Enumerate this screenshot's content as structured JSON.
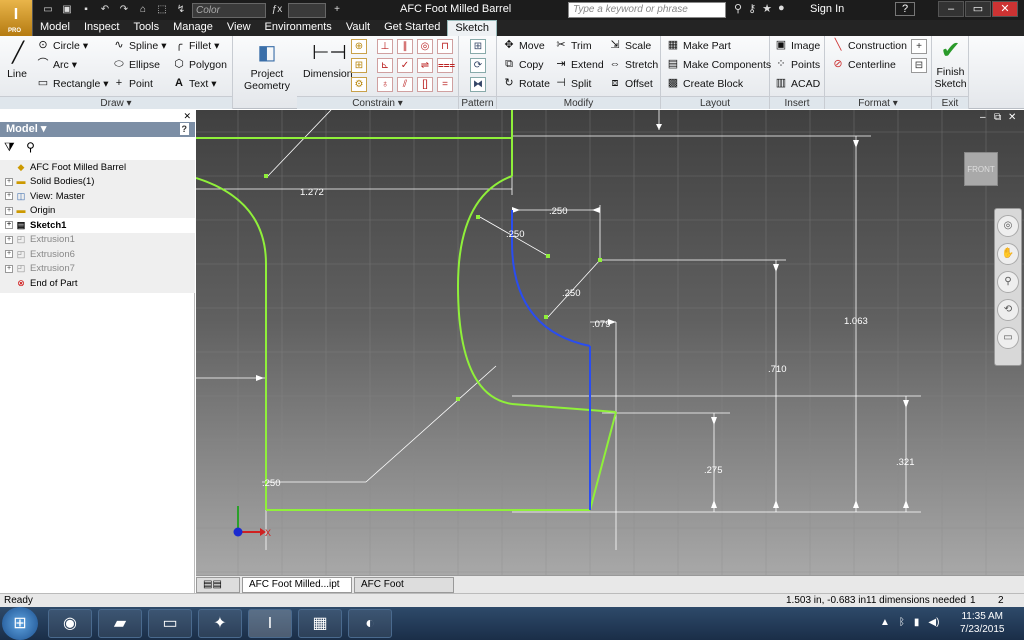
{
  "title_bar": {
    "window_title": "AFC Foot Milled Barrel",
    "color_value": "Color",
    "search_placeholder": "Type a keyword or phrase",
    "sign_in": "Sign In",
    "help": "?",
    "app_badge": "PRO"
  },
  "menu": {
    "tabs": [
      "Model",
      "Inspect",
      "Tools",
      "Manage",
      "View",
      "Environments",
      "Vault",
      "Get Started",
      "Sketch"
    ],
    "active": "Sketch"
  },
  "ribbon": {
    "draw": {
      "label": "Draw",
      "line": "Line",
      "circle": "Circle",
      "arc": "Arc",
      "rectangle": "Rectangle",
      "spline": "Spline",
      "ellipse": "Ellipse",
      "point": "Point",
      "fillet": "Fillet",
      "polygon": "Polygon",
      "text": "Text"
    },
    "project_geometry": "Project Geometry",
    "constrain": {
      "label": "Constrain",
      "dimension": "Dimension"
    },
    "pattern": {
      "label": "Pattern"
    },
    "modify": {
      "label": "Modify",
      "move": "Move",
      "copy": "Copy",
      "rotate": "Rotate",
      "trim": "Trim",
      "extend": "Extend",
      "split": "Split",
      "scale": "Scale",
      "stretch": "Stretch",
      "offset": "Offset"
    },
    "layout": {
      "label": "Layout",
      "make_part": "Make Part",
      "make_components": "Make Components",
      "create_block": "Create Block"
    },
    "insert": {
      "label": "Insert",
      "image": "Image",
      "points": "Points",
      "acad": "ACAD"
    },
    "format": {
      "label": "Format",
      "construction": "Construction",
      "centerline": "Centerline"
    },
    "exit": {
      "label": "Exit",
      "finish_sketch": "Finish Sketch"
    }
  },
  "browser": {
    "title": "Model",
    "tree": [
      {
        "label": "AFC Foot Milled Barrel",
        "state": "normal",
        "expand": false,
        "icon": "part-icon"
      },
      {
        "label": "Solid Bodies(1)",
        "state": "normal",
        "expand": true,
        "icon": "folder-icon"
      },
      {
        "label": "View: Master",
        "state": "normal",
        "expand": true,
        "icon": "view-icon"
      },
      {
        "label": "Origin",
        "state": "normal",
        "expand": true,
        "icon": "folder-icon"
      },
      {
        "label": "Sketch1",
        "state": "active",
        "expand": true,
        "icon": "sketch-icon"
      },
      {
        "label": "Extrusion1",
        "state": "dim",
        "expand": true,
        "icon": "extrusion-icon"
      },
      {
        "label": "Extrusion6",
        "state": "dim",
        "expand": true,
        "icon": "extrusion-icon"
      },
      {
        "label": "Extrusion7",
        "state": "dim",
        "expand": true,
        "icon": "extrusion-icon"
      },
      {
        "label": "End of Part",
        "state": "normal",
        "expand": false,
        "icon": "end-of-part-icon"
      }
    ]
  },
  "canvas": {
    "viewcube_label": "FRONT",
    "dimensions": [
      "1.272",
      ".250",
      ".250",
      ".250",
      ".079",
      "1.063",
      ".710",
      ".275",
      ".321",
      ".250"
    ],
    "axis_x": "X"
  },
  "doc_tabs": [
    "AFC Foot Milled...ipt",
    "AFC Foot Milled...ipt"
  ],
  "status": {
    "ready": "Ready",
    "coords": "1.503 in, -0.683 in",
    "dims_needed": "11 dimensions needed",
    "num1": "1",
    "num2": "2"
  },
  "taskbar": {
    "time": "11:35 AM",
    "date": "7/23/2015"
  }
}
